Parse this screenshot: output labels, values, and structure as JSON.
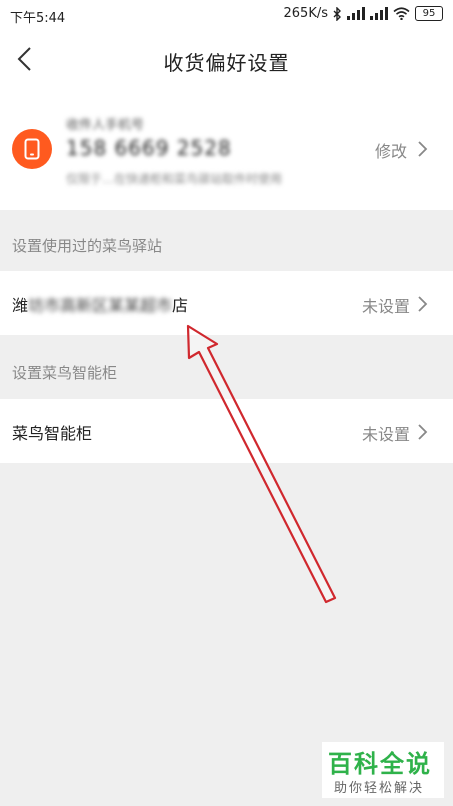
{
  "status_bar": {
    "time": "下午5:44",
    "speed": "265K/s",
    "battery": "95"
  },
  "header": {
    "title": "收货偏好设置"
  },
  "contact": {
    "label": "收件人手机号",
    "phone": "158 6669 2528",
    "note": "仅限于…在快递柜和菜鸟驿站取件时使用",
    "modify_label": "修改",
    "icon": "phone-icon",
    "accent_color": "#ff5a1f"
  },
  "sections": {
    "station_header": "设置使用过的菜鸟驿站",
    "cabinet_header": "设置菜鸟智能柜"
  },
  "station_row": {
    "title_prefix": "潍",
    "title_blurred": "坊市高新区某某超市",
    "title_suffix": "店",
    "value": "未设置"
  },
  "cabinet_row": {
    "title": "菜鸟智能柜",
    "value": "未设置"
  },
  "watermark": {
    "title": "百科全说",
    "subtitle": "助你轻松解决",
    "color": "#2fb24a"
  }
}
